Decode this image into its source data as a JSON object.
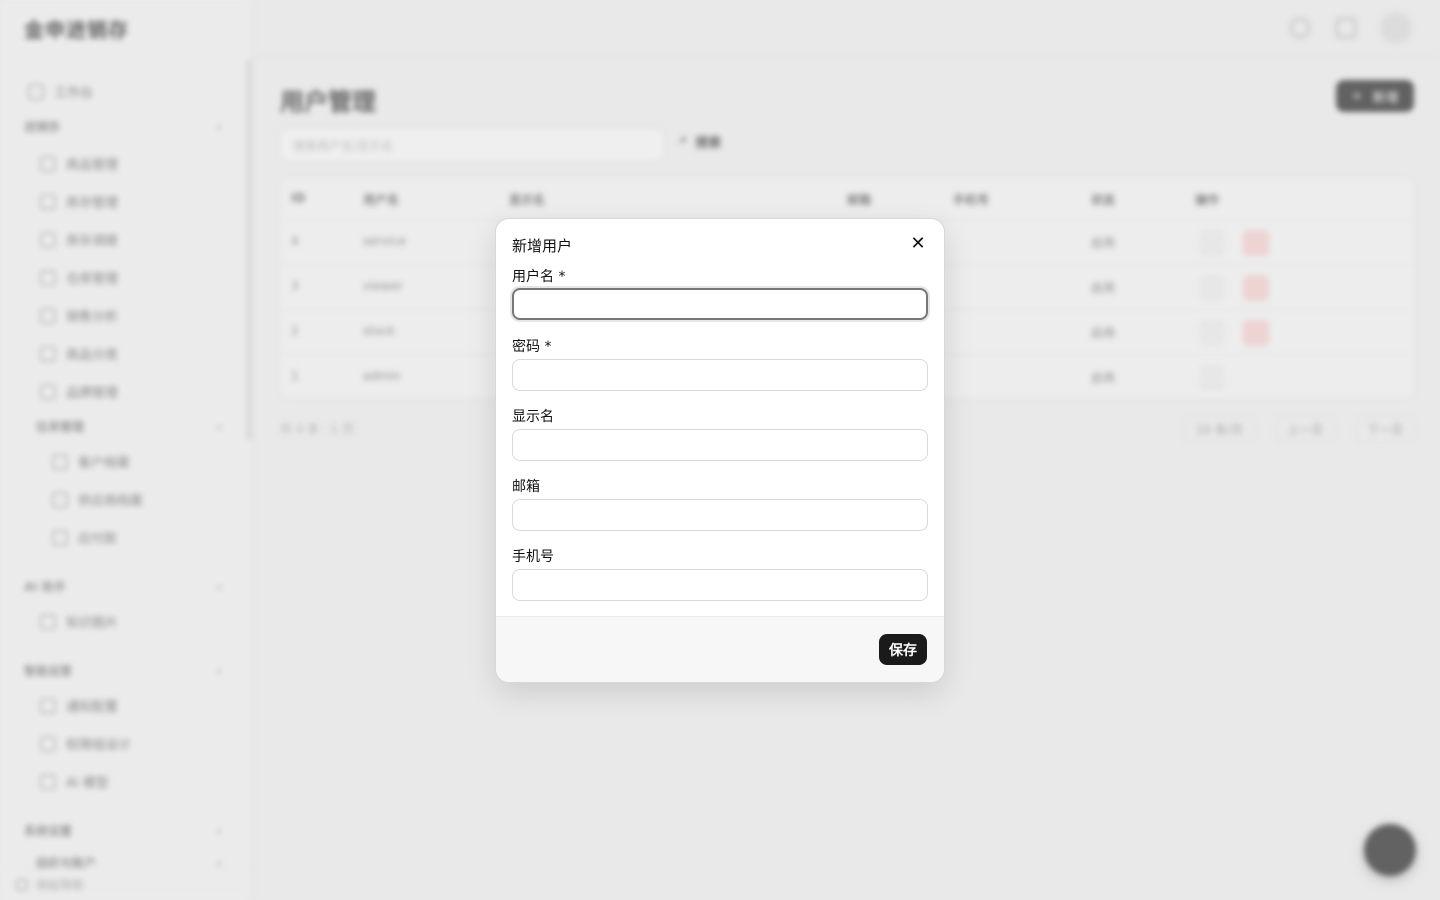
{
  "background": {
    "brand": "金申进销存",
    "sidebar": {
      "items": [
        {
          "label": "工作台",
          "icon": "grid-icon"
        },
        {
          "label": "商品管理",
          "icon": "box-icon"
        },
        {
          "label": "库存管理",
          "icon": "box-icon"
        },
        {
          "label": "库存调拨",
          "icon": "doc-icon"
        },
        {
          "label": "仓库管理",
          "icon": "warehouse-icon"
        },
        {
          "label": "销售分析",
          "icon": "chart-icon"
        },
        {
          "label": "商品分类",
          "icon": "list-icon"
        },
        {
          "label": "品牌管理",
          "icon": "gear-icon"
        },
        {
          "label": "客户档案",
          "icon": "user-icon"
        },
        {
          "label": "供应商档案",
          "icon": "folder-icon"
        },
        {
          "label": "应付款",
          "icon": "calendar-icon"
        },
        {
          "label": "知识图片",
          "icon": "image-icon"
        },
        {
          "label": "通知配置",
          "icon": "bell-icon"
        },
        {
          "label": "权限组设计",
          "icon": "gear-icon"
        },
        {
          "label": "AI 模型",
          "icon": "ai-icon"
        }
      ],
      "groups": [
        "进销存",
        "往来管理",
        "AI 助手",
        "智能运营",
        "系统设置",
        "组织与账户"
      ],
      "footer": "收起导航"
    },
    "page_title": "用户管理",
    "add_button": "新增",
    "search_placeholder": "搜索用户名/显示名",
    "search_button": "搜索",
    "table": {
      "headers": [
        "ID",
        "用户名",
        "显示名",
        "邮箱",
        "手机号",
        "状态",
        "操作"
      ],
      "rows": [
        {
          "id": "4",
          "username": "service",
          "status": "启用",
          "deletable": true
        },
        {
          "id": "3",
          "username": "viewer",
          "status": "启用",
          "deletable": true
        },
        {
          "id": "2",
          "username": "stock",
          "status": "启用",
          "deletable": true
        },
        {
          "id": "1",
          "username": "admin",
          "status": "启用",
          "deletable": false
        }
      ]
    },
    "pager": {
      "summary": "共 4 条",
      "page": "1 页",
      "page_size": "10 条/页",
      "prev": "上一页",
      "next": "下一页"
    }
  },
  "modal": {
    "title": "新增用户",
    "fields": [
      {
        "label": "用户名 *",
        "value": "",
        "placeholder": ""
      },
      {
        "label": "密码 *",
        "value": "",
        "placeholder": ""
      },
      {
        "label": "显示名",
        "value": "",
        "placeholder": ""
      },
      {
        "label": "邮箱",
        "value": "",
        "placeholder": ""
      },
      {
        "label": "手机号",
        "value": "",
        "placeholder": ""
      }
    ],
    "save_label": "保存",
    "close_symbol": "✕"
  }
}
